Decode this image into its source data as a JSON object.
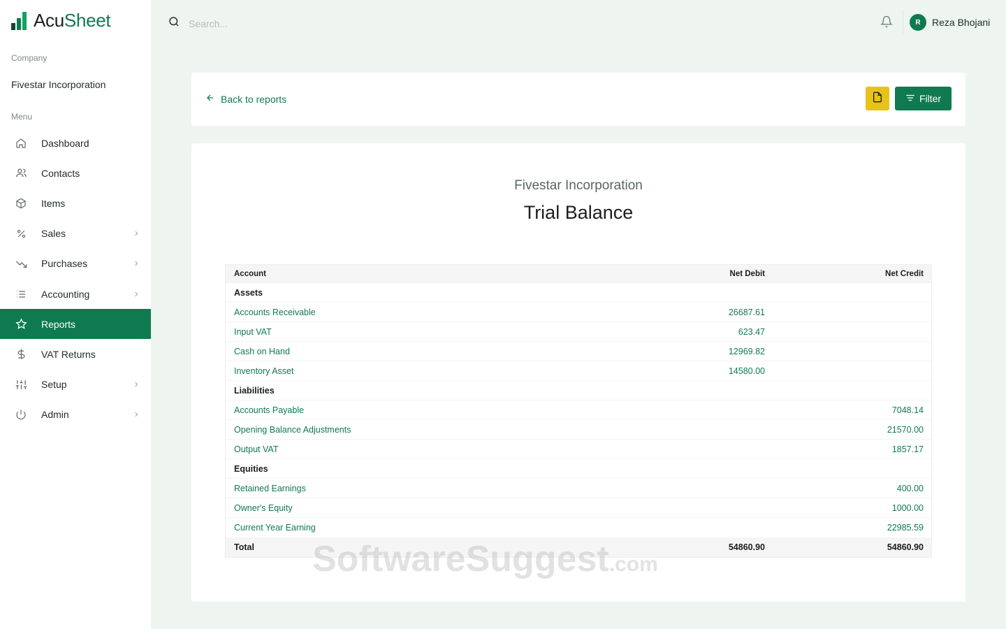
{
  "brand": {
    "name_part1": "Acu",
    "name_part2": "Sheet",
    "accent": "#0f7a4f"
  },
  "sidebar": {
    "company_label": "Company",
    "company_name": "Fivestar Incorporation",
    "menu_label": "Menu",
    "items": [
      {
        "label": "Dashboard",
        "icon": "home-icon",
        "chevron": false
      },
      {
        "label": "Contacts",
        "icon": "users-icon",
        "chevron": false
      },
      {
        "label": "Items",
        "icon": "box-icon",
        "chevron": false
      },
      {
        "label": "Sales",
        "icon": "percent-icon",
        "chevron": true
      },
      {
        "label": "Purchases",
        "icon": "trend-down-icon",
        "chevron": true
      },
      {
        "label": "Accounting",
        "icon": "list-icon",
        "chevron": true
      },
      {
        "label": "Reports",
        "icon": "star-icon",
        "chevron": false,
        "active": true
      },
      {
        "label": "VAT Returns",
        "icon": "dollar-icon",
        "chevron": false
      },
      {
        "label": "Setup",
        "icon": "sliders-icon",
        "chevron": true
      },
      {
        "label": "Admin",
        "icon": "power-icon",
        "chevron": true
      }
    ]
  },
  "topbar": {
    "search_placeholder": "Search...",
    "user_initial": "R",
    "user_name": "Reza Bhojani"
  },
  "toolbar": {
    "back_label": "Back to reports",
    "filter_label": "Filter"
  },
  "report": {
    "company": "Fivestar Incorporation",
    "title": "Trial Balance",
    "headers": {
      "account": "Account",
      "debit": "Net Debit",
      "credit": "Net Credit"
    },
    "rows": [
      {
        "type": "group",
        "account": "Assets",
        "debit": "",
        "credit": ""
      },
      {
        "type": "line",
        "account": "Accounts Receivable",
        "debit": "26687.61",
        "credit": ""
      },
      {
        "type": "line",
        "account": "Input VAT",
        "debit": "623.47",
        "credit": ""
      },
      {
        "type": "line",
        "account": "Cash on Hand",
        "debit": "12969.82",
        "credit": ""
      },
      {
        "type": "line",
        "account": "Inventory Asset",
        "debit": "14580.00",
        "credit": ""
      },
      {
        "type": "group",
        "account": "Liabilities",
        "debit": "",
        "credit": ""
      },
      {
        "type": "line",
        "account": "Accounts Payable",
        "debit": "",
        "credit": "7048.14"
      },
      {
        "type": "line",
        "account": "Opening Balance Adjustments",
        "debit": "",
        "credit": "21570.00"
      },
      {
        "type": "line",
        "account": "Output VAT",
        "debit": "",
        "credit": "1857.17"
      },
      {
        "type": "group",
        "account": "Equities",
        "debit": "",
        "credit": ""
      },
      {
        "type": "line",
        "account": "Retained Earnings",
        "debit": "",
        "credit": "400.00"
      },
      {
        "type": "line",
        "account": "Owner's Equity",
        "debit": "",
        "credit": "1000.00"
      },
      {
        "type": "line",
        "account": "Current Year Earning",
        "debit": "",
        "credit": "22985.59"
      }
    ],
    "total": {
      "label": "Total",
      "debit": "54860.90",
      "credit": "54860.90"
    }
  },
  "watermark": {
    "text": "SoftwareSuggest",
    "suffix": ".com"
  }
}
